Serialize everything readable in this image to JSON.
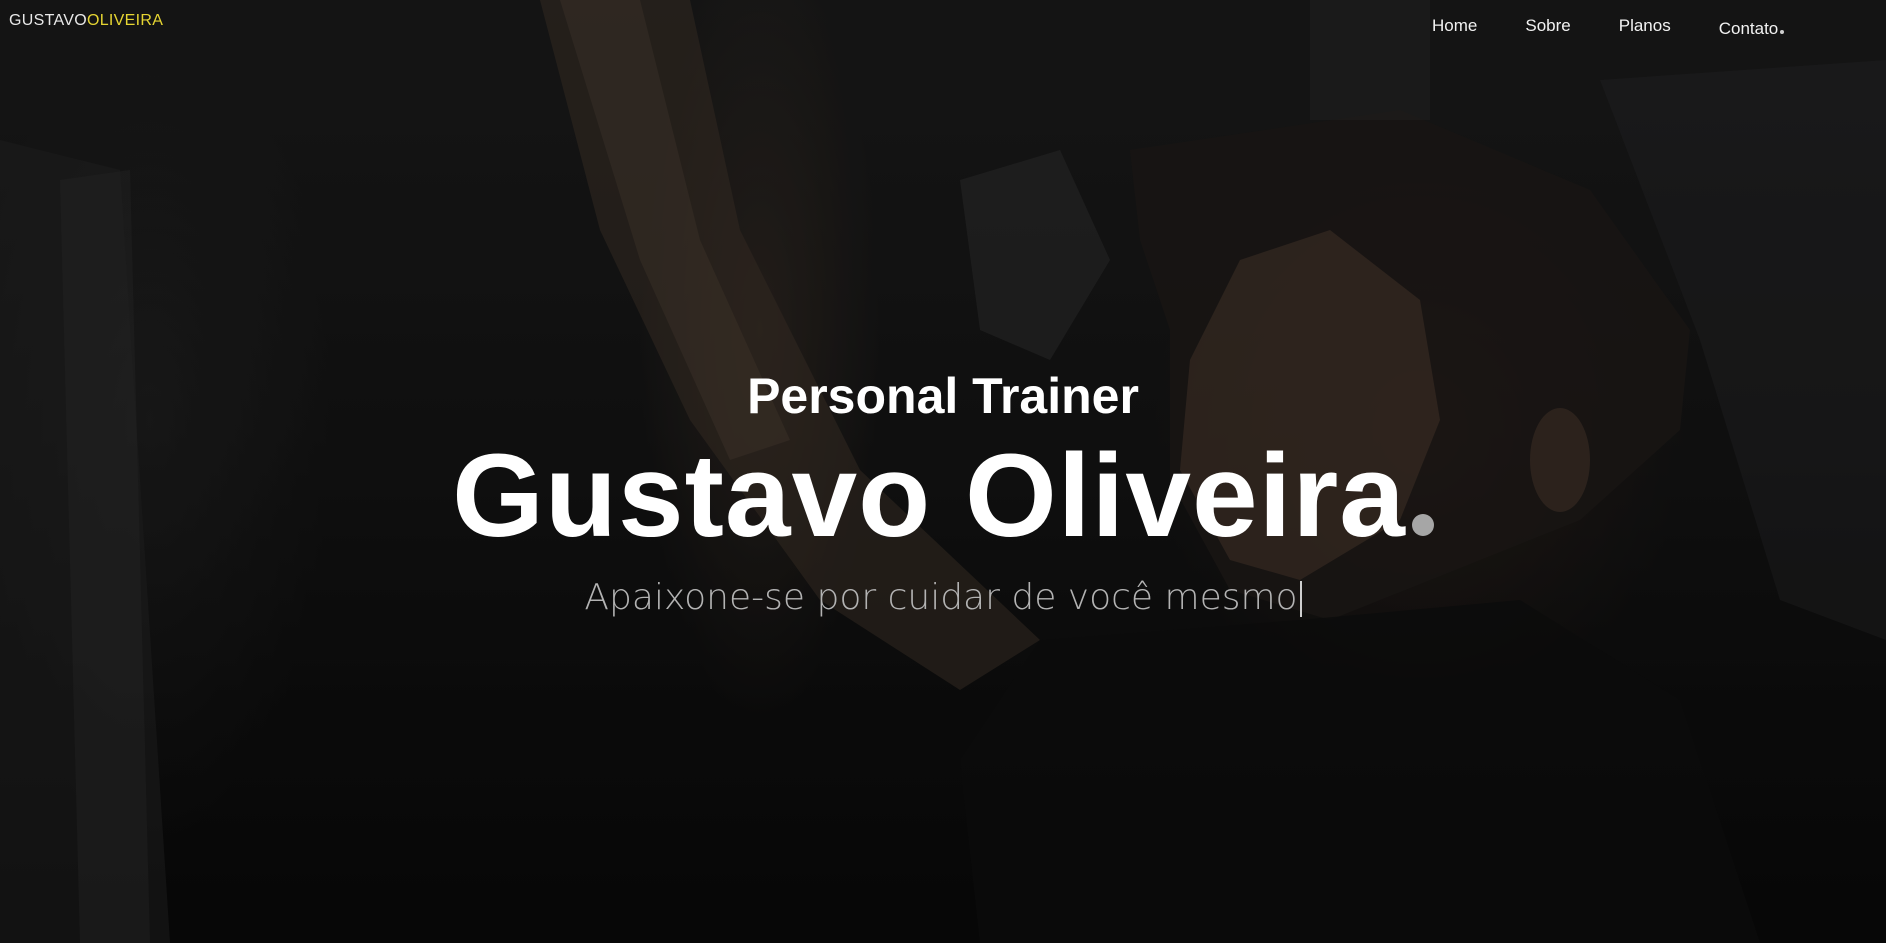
{
  "logo": {
    "first": "GUSTAVO",
    "second": "OLIVEIRA"
  },
  "nav": {
    "items": [
      {
        "label": "Home"
      },
      {
        "label": "Sobre"
      },
      {
        "label": "Planos"
      },
      {
        "label": "Contato"
      }
    ]
  },
  "hero": {
    "subtitle": "Personal Trainer",
    "title": "Gustavo Oliveira",
    "tagline": "Apaixone-se por cuidar de você mesmo"
  },
  "colors": {
    "logo_accent": "#e6d532",
    "background": "#141414",
    "text": "#ffffff",
    "tagline": "#b3b3b3",
    "title_dot": "#a6a6a6"
  },
  "icons": {
    "title_dot": "dot-icon",
    "nav_dot": "dot-icon",
    "cursor": "text-cursor"
  }
}
